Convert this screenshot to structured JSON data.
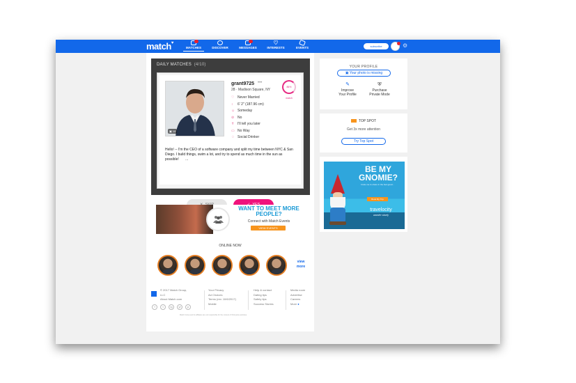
{
  "nav": {
    "logo": "match",
    "items": [
      {
        "label": "MATCHES",
        "icon": "matches-icon",
        "badge": true
      },
      {
        "label": "DISCOVER",
        "icon": "discover-icon",
        "badge": false
      },
      {
        "label": "MESSAGES",
        "icon": "messages-icon",
        "badge": true
      },
      {
        "label": "INTERESTS",
        "icon": "interests-icon",
        "badge": false
      },
      {
        "label": "EVENTS",
        "icon": "events-icon",
        "badge": false
      }
    ],
    "subscribe_label": "subscribe",
    "accent": "#1268ea"
  },
  "daily_matches": {
    "title": "DAILY MATCHES",
    "counter": "(4/10)",
    "username": "grant9725",
    "more": "•••",
    "location": "28 · Madison Square, NY",
    "match_label": "86%\nmatch",
    "photo_count": "10",
    "attributes": [
      {
        "icon": "heart-icon",
        "text": "Never Married"
      },
      {
        "icon": "ruler-icon",
        "text": "6' 2\" (187.96 cm)"
      },
      {
        "icon": "kids-icon",
        "text": "Someday"
      },
      {
        "icon": "smoking-icon",
        "text": "No"
      },
      {
        "icon": "religion-icon",
        "text": "I'll tell you later"
      },
      {
        "icon": "car-icon",
        "text": "No Way"
      },
      {
        "icon": "drink-icon",
        "text": "Social Drinker"
      }
    ],
    "bio": "Hello! -- I'm the CEO of a software company and split my time between NYC & San Diego. I build things, swim a lot, and try to spend as much time in the sun as possible!",
    "bio_more": "...",
    "skip_label": "SKIP",
    "yes_label": "YES",
    "yes_color": "#f0127c"
  },
  "events_ad": {
    "headline": "WANT TO MEET MORE PEOPLE?",
    "sub": "Connect with Match Events",
    "button": "VIEW EVENTS"
  },
  "online_now": {
    "title": "ONLINE NOW",
    "view_more": "view more",
    "count": 5
  },
  "footer": {
    "col1": [
      "© 2017 Match Group,",
      "LLC",
      "About Match.com"
    ],
    "col2": [
      "Your Privacy",
      "Ad Choices",
      "Terms (rev. 10/6/2017)",
      "Mobile"
    ],
    "col3": [
      "Help & contact",
      "Dating tips",
      "Safety tips",
      "Success Stories"
    ],
    "col4": [
      "Media room",
      "Advertise",
      "Careers",
      "More"
    ],
    "social": [
      "f",
      "t",
      "ig",
      "yt",
      "p"
    ],
    "legal": "Match Group and its affiliates are not responsible for the content of third-party websites."
  },
  "your_profile": {
    "title": "YOUR PROFILE",
    "photo_missing": "Your photo is missing",
    "improve": "Improve\nYour Profile",
    "purchase": "Purchase\nPrivate Mode"
  },
  "top_spot": {
    "title": "TOP SPOT",
    "subtitle": "Get 3x more attention",
    "button": "Try Top Spot"
  },
  "gnome_ad": {
    "headline": "BE MY GNOMIE?",
    "sub": "Invite me to share in the feel-good...",
    "button": "Book My Trip",
    "brand": "travelocity",
    "tagline": "wander wisely"
  }
}
